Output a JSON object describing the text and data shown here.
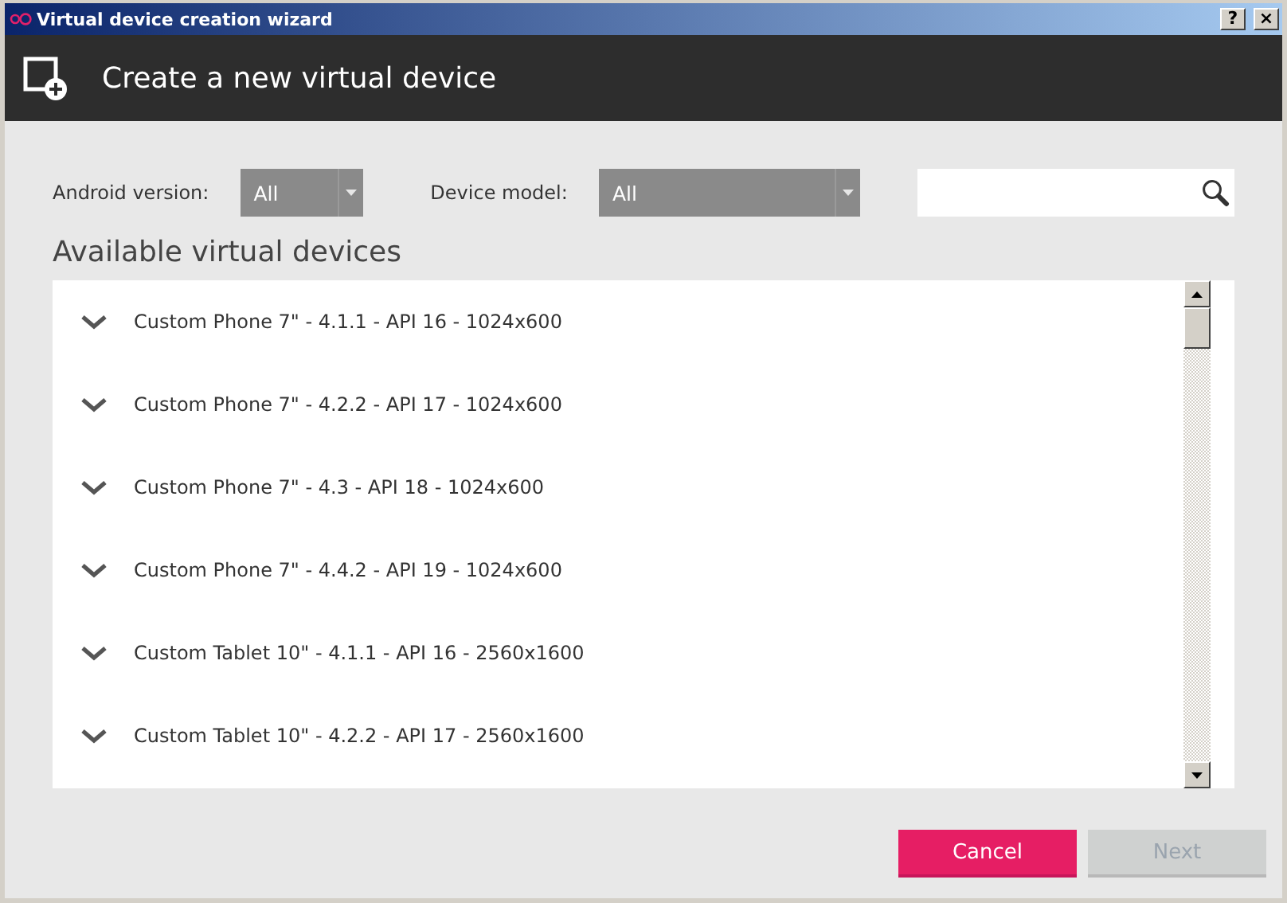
{
  "window": {
    "title": "Virtual device creation wizard",
    "buttons": [
      "?",
      "×"
    ]
  },
  "header": {
    "title": "Create a new virtual device"
  },
  "filters": [
    {
      "label": "Android version:",
      "value": "All"
    },
    {
      "label": "Device model:",
      "value": "All"
    }
  ],
  "list": {
    "title": "Available virtual devices",
    "items": [
      {
        "label": "Custom Phone 7\" - 4.1.1 - API 16 - 1024x600",
        "expanded": false
      },
      {
        "label": "Custom Phone 7\" - 4.2.2 - API 17 - 1024x600",
        "expanded": false
      },
      {
        "label": "Custom Phone 7\" - 4.3 - API 18 - 1024x600",
        "expanded": false
      },
      {
        "label": "Custom Phone 7\" - 4.4.2 - API 19 - 1024x600",
        "expanded": false
      },
      {
        "label": "Custom Tablet 10\" - 4.1.1 - API 16 - 2560x1600",
        "expanded": false
      },
      {
        "label": "Custom Tablet 10\" - 4.2.2 - API 17 - 2560x1600",
        "expanded": false
      }
    ]
  },
  "buttons": [
    {
      "label": "Cancel",
      "kind": "primary",
      "disabled": false
    },
    {
      "label": "Next",
      "kind": "secondary",
      "disabled": true
    }
  ]
}
